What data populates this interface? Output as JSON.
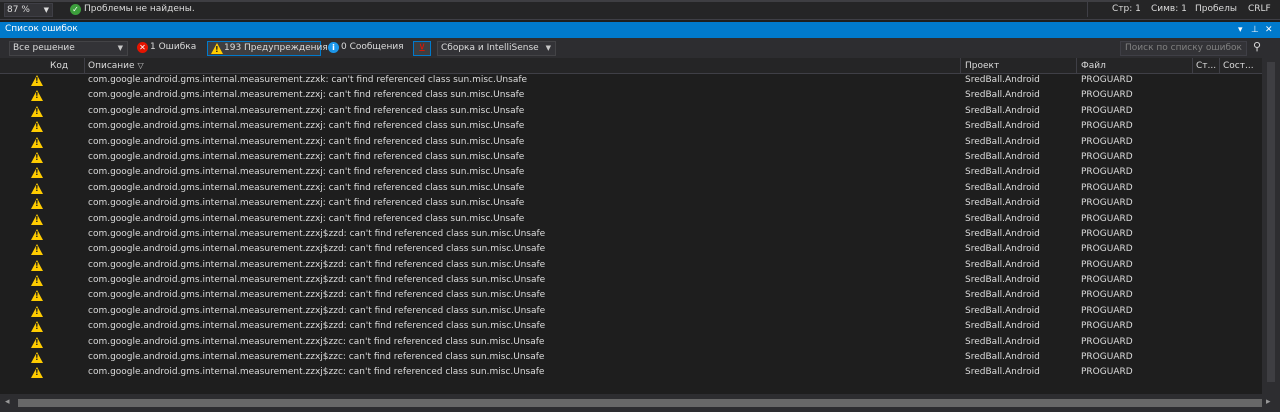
{
  "statusbar": {
    "zoom": "87 %",
    "message": "Проблемы не найдены.",
    "line": "Стр: 1",
    "col": "Симв: 1",
    "whitespace": "Пробелы",
    "line_endings": "CRLF"
  },
  "panel": {
    "title": "Список ошибок"
  },
  "toolbar": {
    "scope": "Все решение",
    "errors": "1 Ошибка",
    "warnings": "193 Предупреждения",
    "messages": "0 Сообщения",
    "build_filter": "Сборка и IntelliSense",
    "search_placeholder": "Поиск по списку ошибок"
  },
  "columns": {
    "code": "Код",
    "description": "Описание",
    "project": "Проект",
    "file": "Файл",
    "line": "Ст...",
    "state": "Сост..."
  },
  "rows": [
    {
      "description": "com.google.android.gms.internal.measurement.zzxk: can't find referenced class sun.misc.Unsafe",
      "project": "SredBall.Android",
      "file": "PROGUARD"
    },
    {
      "description": "com.google.android.gms.internal.measurement.zzxj: can't find referenced class sun.misc.Unsafe",
      "project": "SredBall.Android",
      "file": "PROGUARD"
    },
    {
      "description": "com.google.android.gms.internal.measurement.zzxj: can't find referenced class sun.misc.Unsafe",
      "project": "SredBall.Android",
      "file": "PROGUARD"
    },
    {
      "description": "com.google.android.gms.internal.measurement.zzxj: can't find referenced class sun.misc.Unsafe",
      "project": "SredBall.Android",
      "file": "PROGUARD"
    },
    {
      "description": "com.google.android.gms.internal.measurement.zzxj: can't find referenced class sun.misc.Unsafe",
      "project": "SredBall.Android",
      "file": "PROGUARD"
    },
    {
      "description": "com.google.android.gms.internal.measurement.zzxj: can't find referenced class sun.misc.Unsafe",
      "project": "SredBall.Android",
      "file": "PROGUARD"
    },
    {
      "description": "com.google.android.gms.internal.measurement.zzxj: can't find referenced class sun.misc.Unsafe",
      "project": "SredBall.Android",
      "file": "PROGUARD"
    },
    {
      "description": "com.google.android.gms.internal.measurement.zzxj: can't find referenced class sun.misc.Unsafe",
      "project": "SredBall.Android",
      "file": "PROGUARD"
    },
    {
      "description": "com.google.android.gms.internal.measurement.zzxj: can't find referenced class sun.misc.Unsafe",
      "project": "SredBall.Android",
      "file": "PROGUARD"
    },
    {
      "description": "com.google.android.gms.internal.measurement.zzxj: can't find referenced class sun.misc.Unsafe",
      "project": "SredBall.Android",
      "file": "PROGUARD"
    },
    {
      "description": "com.google.android.gms.internal.measurement.zzxj$zzd: can't find referenced class sun.misc.Unsafe",
      "project": "SredBall.Android",
      "file": "PROGUARD"
    },
    {
      "description": "com.google.android.gms.internal.measurement.zzxj$zzd: can't find referenced class sun.misc.Unsafe",
      "project": "SredBall.Android",
      "file": "PROGUARD"
    },
    {
      "description": "com.google.android.gms.internal.measurement.zzxj$zzd: can't find referenced class sun.misc.Unsafe",
      "project": "SredBall.Android",
      "file": "PROGUARD"
    },
    {
      "description": "com.google.android.gms.internal.measurement.zzxj$zzd: can't find referenced class sun.misc.Unsafe",
      "project": "SredBall.Android",
      "file": "PROGUARD"
    },
    {
      "description": "com.google.android.gms.internal.measurement.zzxj$zzd: can't find referenced class sun.misc.Unsafe",
      "project": "SredBall.Android",
      "file": "PROGUARD"
    },
    {
      "description": "com.google.android.gms.internal.measurement.zzxj$zzd: can't find referenced class sun.misc.Unsafe",
      "project": "SredBall.Android",
      "file": "PROGUARD"
    },
    {
      "description": "com.google.android.gms.internal.measurement.zzxj$zzd: can't find referenced class sun.misc.Unsafe",
      "project": "SredBall.Android",
      "file": "PROGUARD"
    },
    {
      "description": "com.google.android.gms.internal.measurement.zzxj$zzc: can't find referenced class sun.misc.Unsafe",
      "project": "SredBall.Android",
      "file": "PROGUARD"
    },
    {
      "description": "com.google.android.gms.internal.measurement.zzxj$zzc: can't find referenced class sun.misc.Unsafe",
      "project": "SredBall.Android",
      "file": "PROGUARD"
    },
    {
      "description": "com.google.android.gms.internal.measurement.zzxj$zzc: can't find referenced class sun.misc.Unsafe",
      "project": "SredBall.Android",
      "file": "PROGUARD"
    }
  ]
}
